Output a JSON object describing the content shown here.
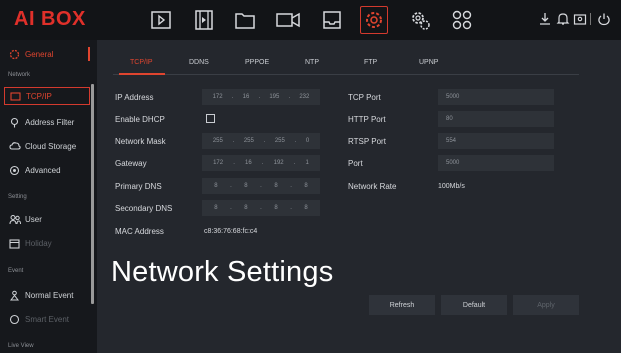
{
  "app": {
    "logo": "AI BOX"
  },
  "topnav": {
    "icons": [
      "play-icon",
      "film-icon",
      "folder-icon",
      "camera-icon",
      "inbox-icon",
      "settings-icon",
      "network-gear-icon",
      "apps-grid-icon"
    ],
    "active_index": 5,
    "right_icons": [
      "download-icon",
      "bell-icon",
      "user-badge-icon",
      "power-icon"
    ]
  },
  "sidebar": {
    "items": [
      {
        "label": "General",
        "icon": "gear-icon",
        "state": "active"
      },
      {
        "group": "Network"
      },
      {
        "label": "TCP/IP",
        "icon": "network-icon",
        "state": "selected"
      },
      {
        "label": "Address Filter",
        "icon": "filter-icon",
        "state": "normal"
      },
      {
        "label": "Cloud Storage",
        "icon": "cloud-icon",
        "state": "normal"
      },
      {
        "label": "Advanced",
        "icon": "advanced-icon",
        "state": "normal"
      },
      {
        "group": "Setting"
      },
      {
        "label": "User",
        "icon": "users-icon",
        "state": "normal"
      },
      {
        "label": "Holiday",
        "icon": "calendar-icon",
        "state": "disabled"
      },
      {
        "group": "Event"
      },
      {
        "label": "Normal Event",
        "icon": "event-icon",
        "state": "normal"
      },
      {
        "label": "Smart Event",
        "icon": "smart-event-icon",
        "state": "disabled"
      },
      {
        "group": "Live View"
      }
    ]
  },
  "tabs": [
    "TCP/IP",
    "DDNS",
    "PPPOE",
    "NTP",
    "FTP",
    "UPNP"
  ],
  "active_tab": "TCP/IP",
  "form": {
    "ip_address": {
      "label": "IP Address",
      "octets": [
        "172",
        "16",
        "195",
        "232"
      ]
    },
    "enable_dhcp": {
      "label": "Enable DHCP",
      "checked": false
    },
    "network_mask": {
      "label": "Network Mask",
      "octets": [
        "255",
        "255",
        "255",
        "0"
      ]
    },
    "gateway": {
      "label": "Gateway",
      "octets": [
        "172",
        "16",
        "192",
        "1"
      ]
    },
    "primary_dns": {
      "label": "Primary DNS",
      "octets": [
        "8",
        "8",
        "8",
        "8"
      ]
    },
    "secondary_dns": {
      "label": "Secondary DNS",
      "octets": [
        "8",
        "8",
        "8",
        "8"
      ]
    },
    "mac_address": {
      "label": "MAC Address",
      "value": "c8:36:76:68:fc:c4"
    },
    "tcp_port": {
      "label": "TCP Port",
      "value": "5000"
    },
    "http_port": {
      "label": "HTTP Port",
      "value": "80"
    },
    "rtsp_port": {
      "label": "RTSP Port",
      "value": "554"
    },
    "https_port": {
      "label": "Port",
      "value": "5000"
    },
    "network_rate": {
      "label": "Network Rate",
      "value": "100Mb/s"
    }
  },
  "overlay_title": "Network Settings",
  "buttons": {
    "refresh": "Refresh",
    "default": "Default",
    "apply": "Apply"
  },
  "colors": {
    "accent": "#e0452f",
    "bg": "#24272d",
    "sidebar": "#16181c",
    "topbar": "#121417"
  }
}
